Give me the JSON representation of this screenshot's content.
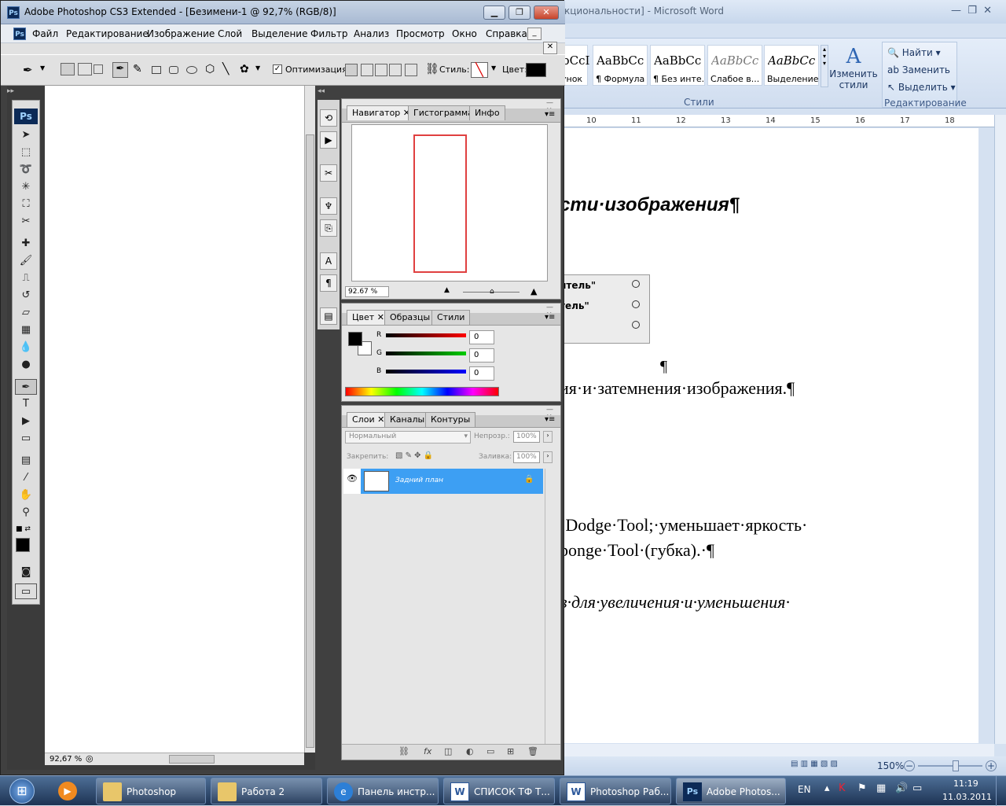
{
  "word": {
    "title": "кциональности] - Microsoft Word",
    "ribbon_styles": [
      {
        "preview": "bCcI",
        "name": "унок"
      },
      {
        "preview": "AaBbCc",
        "name": "¶ Формула"
      },
      {
        "preview": "AaBbCc",
        "name": "¶ Без инте..."
      },
      {
        "preview": "AaBbCc",
        "name": "Слабое в..."
      },
      {
        "preview": "AaBbCc",
        "name": "Выделение"
      }
    ],
    "change_styles": "Изменить стили",
    "styles_group": "Стили",
    "editing": {
      "find": "Найти",
      "replace": "Заменить",
      "select": "Выделить",
      "group": "Редактирование"
    },
    "ruler_numbers": [
      "10",
      "11",
      "12",
      "13",
      "14",
      "15",
      "16",
      "17",
      "18"
    ],
    "doc_lines": {
      "heading": "сти·изображения¶",
      "dialog_item_1": "итель\"",
      "dialog_item_2": "тель\"",
      "pilcrow": "¶",
      "line1": "ия·и·затемнения·изображения.¶",
      "line2": "·Dodge·Tool;·уменьшает·яркость·",
      "line3": "ponge·Tool·(губка).·¶",
      "line4": "в·для·увеличения·и·уменьшения·"
    },
    "zoom": "150%"
  },
  "photoshop": {
    "logo": "Ps",
    "title": "Adobe Photoshop CS3 Extended - [Безимени-1 @ 92,7% (RGB/8)]",
    "menu": [
      "Файл",
      "Редактирование",
      "Изображение",
      "Слой",
      "Выделение",
      "Фильтр",
      "Анализ",
      "Просмотр",
      "Окно",
      "Справка"
    ],
    "options": {
      "optimize": "Оптимизация",
      "style": "Стиль:",
      "color": "Цвет:"
    },
    "status_zoom": "92,67 %",
    "navigator": {
      "tabs": [
        "Навигатор",
        "Гистограмма",
        "Инфо"
      ],
      "zoom": "92.67 %"
    },
    "color": {
      "tabs": [
        "Цвет",
        "Образцы",
        "Стили"
      ],
      "channels": [
        {
          "label": "R",
          "value": "0"
        },
        {
          "label": "G",
          "value": "0"
        },
        {
          "label": "B",
          "value": "0"
        }
      ]
    },
    "layers": {
      "tabs": [
        "Слои",
        "Каналы",
        "Контуры"
      ],
      "blend_mode": "Нормальный",
      "opacity_label": "Непрозр.:",
      "opacity": "100%",
      "lock_label": "Закрепить:",
      "fill_label": "Заливка:",
      "fill": "100%",
      "layer_name": "Задний план"
    }
  },
  "taskbar": {
    "buttons": [
      "Photoshop",
      "Работа 2",
      "Панель инстр...",
      "СПИСОК ТФ Т...",
      "Photoshop Раб...",
      "Adobe Photos..."
    ],
    "lang": "EN",
    "time": "11:19",
    "date": "11.03.2011"
  }
}
